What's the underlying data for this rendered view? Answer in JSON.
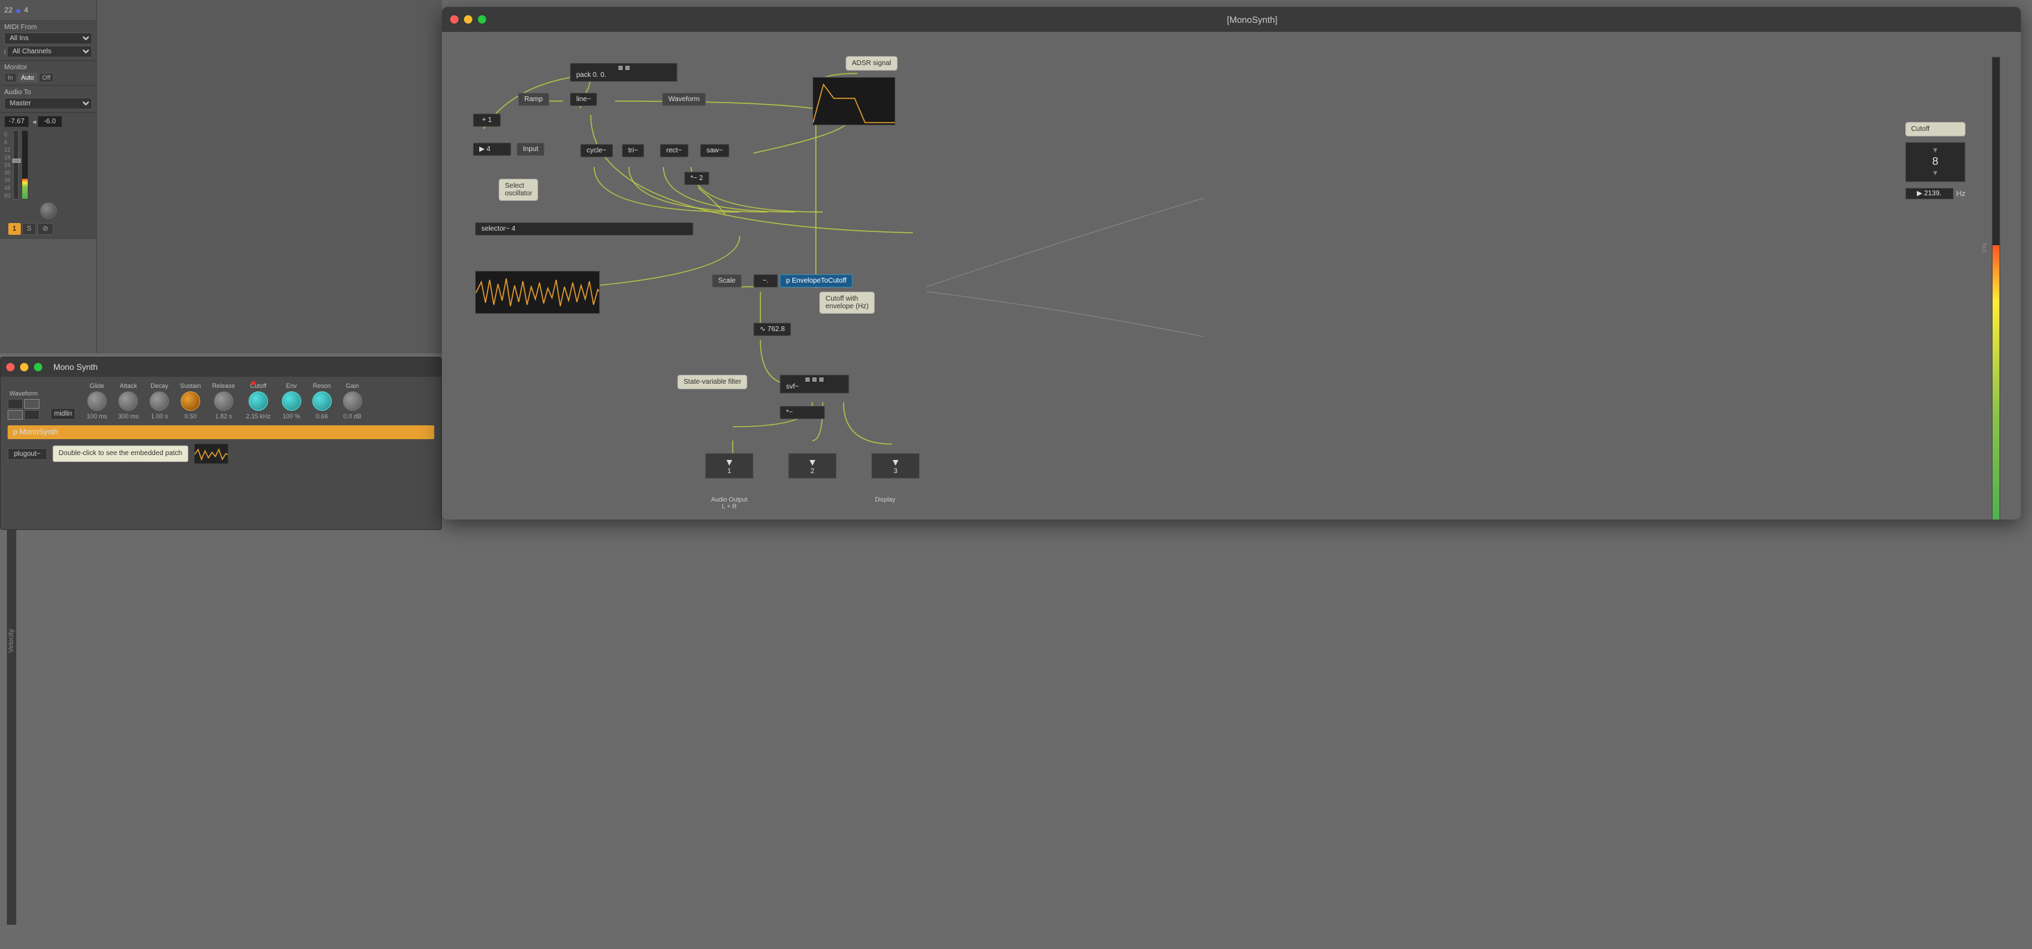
{
  "window": {
    "title": "[MonoSynth]"
  },
  "left_panel": {
    "track_number": "22",
    "track_icon": "●",
    "track_num2": "4",
    "midi_from_label": "MIDI From",
    "all_ins": "All Ins",
    "all_channels": "All Channels",
    "monitor_label": "Monitor",
    "monitor_in": "In",
    "monitor_auto": "Auto",
    "monitor_off": "Off",
    "audio_to_label": "Audio To",
    "master": "Master",
    "vol1": "-7.67",
    "vol2": "-6.0",
    "track_num_btn": "1",
    "track_s_btn": "S",
    "markers": [
      "0",
      "6",
      "12",
      "18",
      "24",
      "30",
      "36",
      "48",
      "60"
    ]
  },
  "instrument": {
    "title": "Mono Synth",
    "params": {
      "waveform_label": "Waveform",
      "glide_label": "Glide",
      "attack_label": "Attack",
      "decay_label": "Decay",
      "sustain_label": "Sustain",
      "release_label": "Release",
      "cutoff_label": "Cutoff",
      "env_label": "Env",
      "reson_label": "Reson",
      "gain_label": "Gain",
      "glide_val": "100 ms",
      "attack_val": "300 ms",
      "decay_val": "1.00 s",
      "sustain_val": "0.50",
      "release_val": "1.82 s",
      "cutoff_val": "2.15 kHz",
      "env_val": "100 %",
      "reson_val": "0.66",
      "gain_val": "0.0 dB"
    },
    "midlin": "midlin",
    "p_mono": "p MonoSynth",
    "plugout": "plugout~",
    "tooltip": "Double-click to see\nthe embedded patch"
  },
  "patch": {
    "pack": "pack 0. 0.",
    "plus1": "+ 1",
    "four": "▶ 4",
    "input": "Input",
    "ramp": "Ramp",
    "line_tilde": "line~",
    "waveform_node": "Waveform",
    "cycle_tilde": "cycle~",
    "tri_tilde": "tri~",
    "rect_tilde": "rect~",
    "saw_tilde": "saw~",
    "mult_tilde": "*~ 2",
    "selector_tilde": "selector~ 4",
    "select_osc": "Select\noscillator",
    "scale": "Scale",
    "tilde_node": "~.",
    "p_envelope": "p EnvelopeToCutoff",
    "cutoff_with_env": "Cutoff with\nenvelope (Hz)",
    "svf_tilde": "svf~",
    "mult_out": "*~",
    "freq_val": "∿ 762.8",
    "state_var": "State-variable filter",
    "adsr_signal": "ADSR signal",
    "out1_label": "Audio Output\nL + R",
    "out2_label": "Display",
    "cutoff_label": "Cutoff",
    "cutoff_val": "8",
    "freq_hz": "▶ 2139.",
    "hz_label": "Hz"
  }
}
